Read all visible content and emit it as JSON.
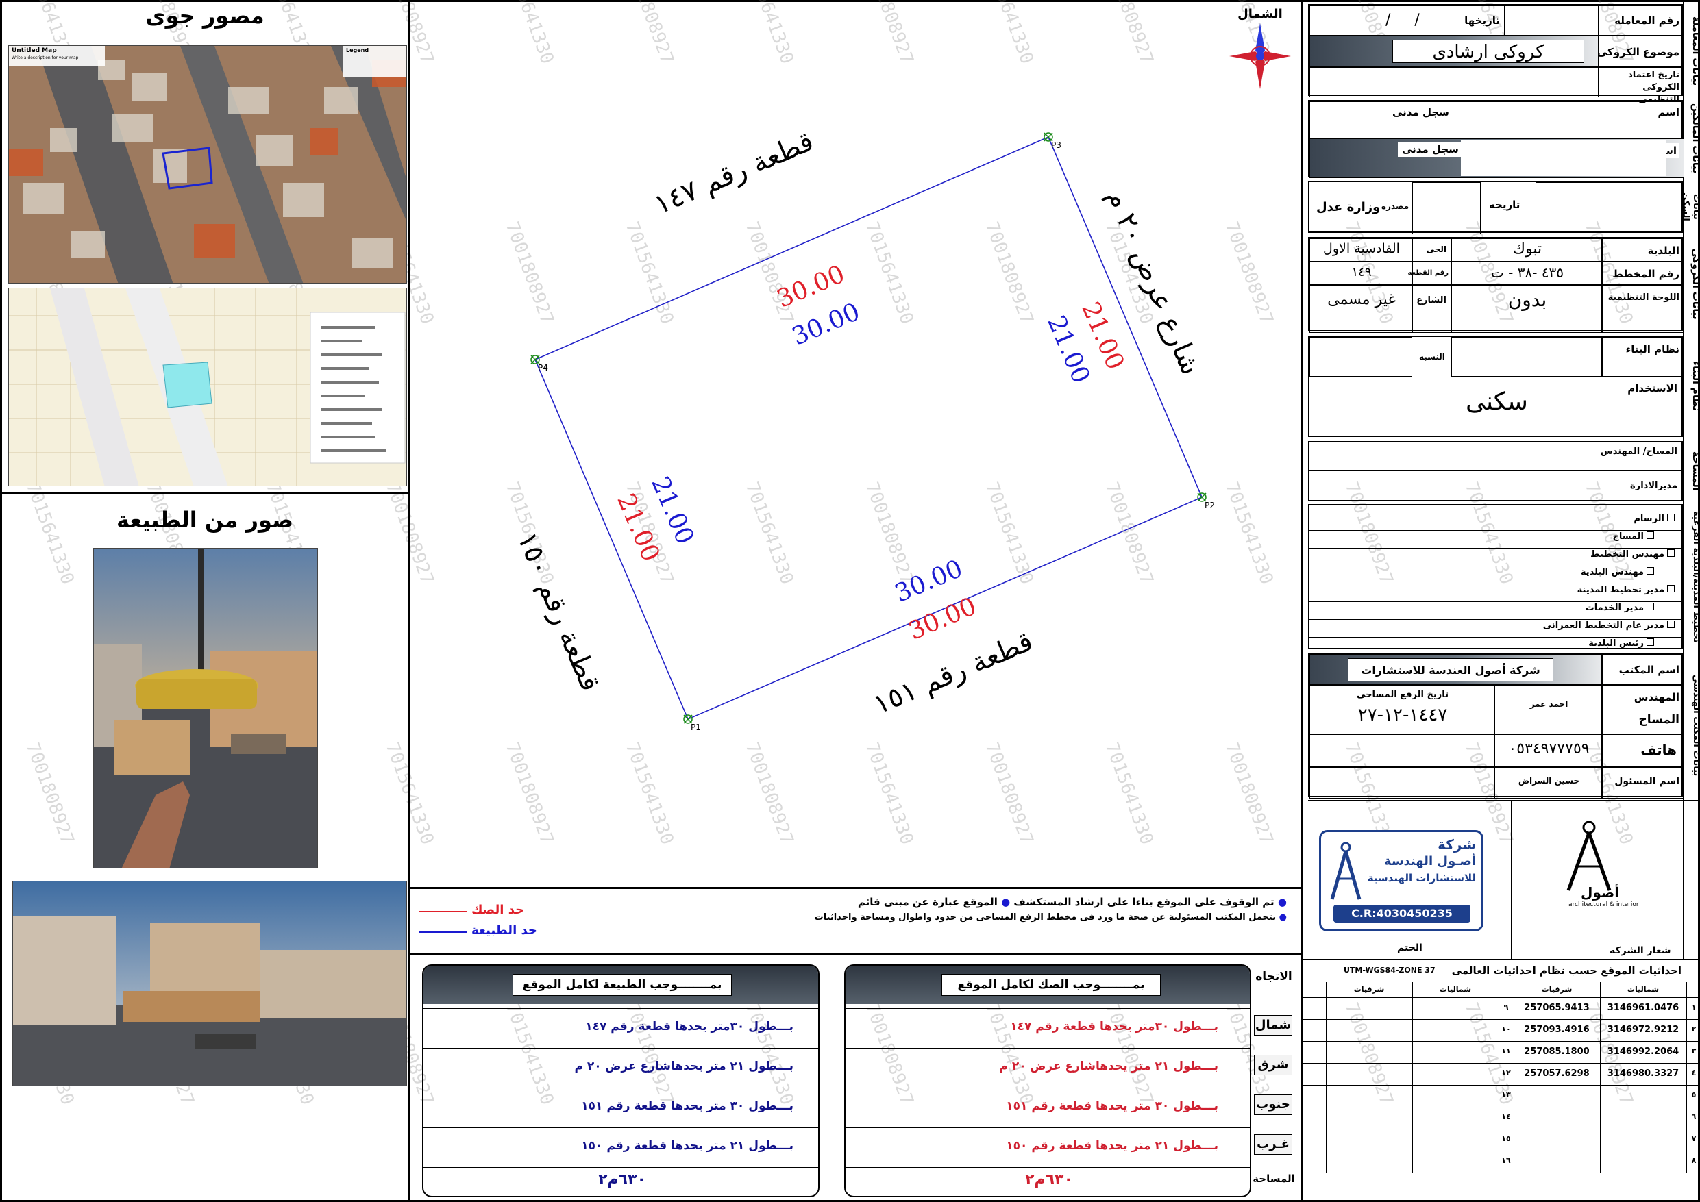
{
  "left": {
    "aerial_title": "مصور جوى",
    "nature_title": "صور من الطبيعة",
    "mini_map_title": "Untitled Map",
    "mini_map_subtitle": "Write a description for your map",
    "legend_title": "Legend"
  },
  "compass": {
    "label": "الشمال"
  },
  "plot": {
    "points": [
      "P1",
      "P2",
      "P3",
      "P4"
    ],
    "north_neighbor": "قطعة رقم ١٤٧",
    "east_neighbor": "شارع عرض ٢٠ م",
    "south_neighbor": "قطعة رقم ١٥١",
    "west_neighbor": "قطعة رقم ١٥٠",
    "top_deed": "30.00",
    "top_nature": "30.00",
    "right_deed": "21.00",
    "right_nature": "21.00",
    "bottom_deed": "30.00",
    "bottom_nature": "30.00",
    "left_deed": "21.00",
    "left_nature": "21.00"
  },
  "notes": {
    "line1": "تم الوقوف على الموقع بناءا على ارشاد المستكشف",
    "line1b": "الموقع عبارة عن مبنى قائم",
    "line2": "يتحمل المكتب المسئولية عن صحة ما ورد فى مخطط الرفع المساحى من حدود واطوال ومساحة واحداثيات",
    "legend_deed": "حد الصك",
    "legend_nature": "حد الطبيعة"
  },
  "boundaries": {
    "direction_header": "الاتجاه",
    "deed_header": "بمــــــــوجب الصك لكامل الموقع",
    "nature_header": "بمــــــــوجب الطبيعة لكامل الموقع",
    "rows": [
      {
        "dir": "شمال",
        "deed": "بـــطول ٣٠متر يحدها قطعة رقم ١٤٧",
        "nature": "بـــطول ٣٠متر يحدها قطعة رقم ١٤٧"
      },
      {
        "dir": "شرق",
        "deed": "بـــطول ٢١ متر يحدهاشارع عرض ٢٠ م",
        "nature": "بـــطول ٢١ متر يحدهاشارع عرض ٢٠ م"
      },
      {
        "dir": "جنوب",
        "deed": "بـــطول ٣٠ متر يحدها قطعة رقم ١٥١",
        "nature": "بـــطول ٣٠ متر يحدها قطعة رقم ١٥١"
      },
      {
        "dir": "غـرب",
        "deed": "بـــطول ٢١ متر يحدها قطعة رقم ١٥٠",
        "nature": "بـــطول ٢١ متر يحدها قطعة رقم ١٥٠"
      }
    ],
    "area_label": "المساحة",
    "area_deed": "٦٣٠م٢",
    "area_nature": "٦٣٠م٢"
  },
  "transaction": {
    "side_label": "بيانات المعاملة",
    "number_label": "رقم المعامله",
    "date_label": "تاريخها",
    "date_value": "/     /",
    "subject_label": "موضوع الكروكى",
    "subject_value": "كروكى ارشادى",
    "approval_label": "تاريخ اعتماد الكروكى التنظيمى"
  },
  "owners": {
    "side_label": "بيانات المالكين",
    "name_label": "اسم",
    "civil_label": "سجل مدنى",
    "name_label2": "اسم",
    "civil_label2": "سجل مدنى"
  },
  "deed": {
    "side_label": "بيانات السكن",
    "date_label": "تاريخه",
    "source_label": "مصدره",
    "source_value": "وزارة عدل"
  },
  "croquis": {
    "side_label": "بيانات الكروكى",
    "municipality_label": "البلدية",
    "municipality_value": "تبوك",
    "district_label": "الحى",
    "district_value": "القادسية الاول",
    "plan_label": "رقم المخطط",
    "plan_value": "٤٣٥ -٣٨ - ت",
    "plot_label": "رقم القطعه",
    "plot_value": "١٤٩",
    "board_label": "اللوحة التنظيمية",
    "board_value": "بدون",
    "street_label": "الشارع",
    "street_value": "غير مسمى"
  },
  "building": {
    "side_label": "نظام البناء",
    "system_label": "نظام البناء",
    "ratio_label": "النسبه",
    "use_label": "الاستخدام",
    "use_value": "سكنى"
  },
  "survey": {
    "side_label": "المساحة",
    "engineer_label": "المساح/ المهندس",
    "manager_label": "مديرالادارة"
  },
  "planning": {
    "side_label": "تخطيط المدينة/البلدية الفرعية",
    "items": [
      "الرسام",
      "المساح",
      "مهندس التخطيط",
      "مهندس البلدية",
      "مدير تخطيط المدينة",
      "مدير الخدمات",
      "مدير عام التخطيط العمرانى",
      "رئيس البلدية"
    ]
  },
  "office": {
    "side_label": "بيانات المكتب الهندسى",
    "name_label": "اسم المكتب",
    "name_value": "شركة أصول العندسة للاستشارات",
    "engineer_label": "المهندس",
    "surveyor_label": "المساح",
    "surveyor_value": "احمد عمر",
    "survey_date_label": "تاريخ الرفع المساحى",
    "survey_date_value": "١٤٤٧-١٢-٢٧",
    "phone_label": "هاتف",
    "phone_value": "٠٥٣٤٩٧٧٧٥٩",
    "responsible_label": "اسم المسئول",
    "responsible_value": "حسين السراض"
  },
  "stamps": {
    "company_logo_label": "شعار الشركة",
    "stamp_label": "الختم",
    "logo_word": "أصول",
    "logo_sub": "architectural & interior",
    "stamp_company": "شركة",
    "stamp_line1": "أصـول الهندسة",
    "stamp_line2": "للاستشارات الهندسية",
    "stamp_cr": "C.R:4030450235"
  },
  "coords": {
    "title": "احداثيات الموقع حسب نظام احداثيات العالمى",
    "system": "UTM-WGS84-ZONE 37",
    "col_north": "شماليات",
    "col_east": "شرقيات",
    "rows_left": [
      {
        "n": "١",
        "north": "3146961.0476",
        "east": "257065.9413"
      },
      {
        "n": "٢",
        "north": "3146972.9212",
        "east": "257093.4916"
      },
      {
        "n": "٣",
        "north": "3146992.2064",
        "east": "257085.1800"
      },
      {
        "n": "٤",
        "north": "3146980.3327",
        "east": "257057.6298"
      },
      {
        "n": "٥",
        "north": "",
        "east": ""
      },
      {
        "n": "٦",
        "north": "",
        "east": ""
      },
      {
        "n": "٧",
        "north": "",
        "east": ""
      },
      {
        "n": "٨",
        "north": "",
        "east": ""
      }
    ],
    "rows_right": [
      "٩",
      "١٠",
      "١١",
      "١٢",
      "١٣",
      "١٤",
      "١٥",
      "١٦"
    ]
  },
  "watermark": [
    "7015641330",
    "7001808927"
  ]
}
